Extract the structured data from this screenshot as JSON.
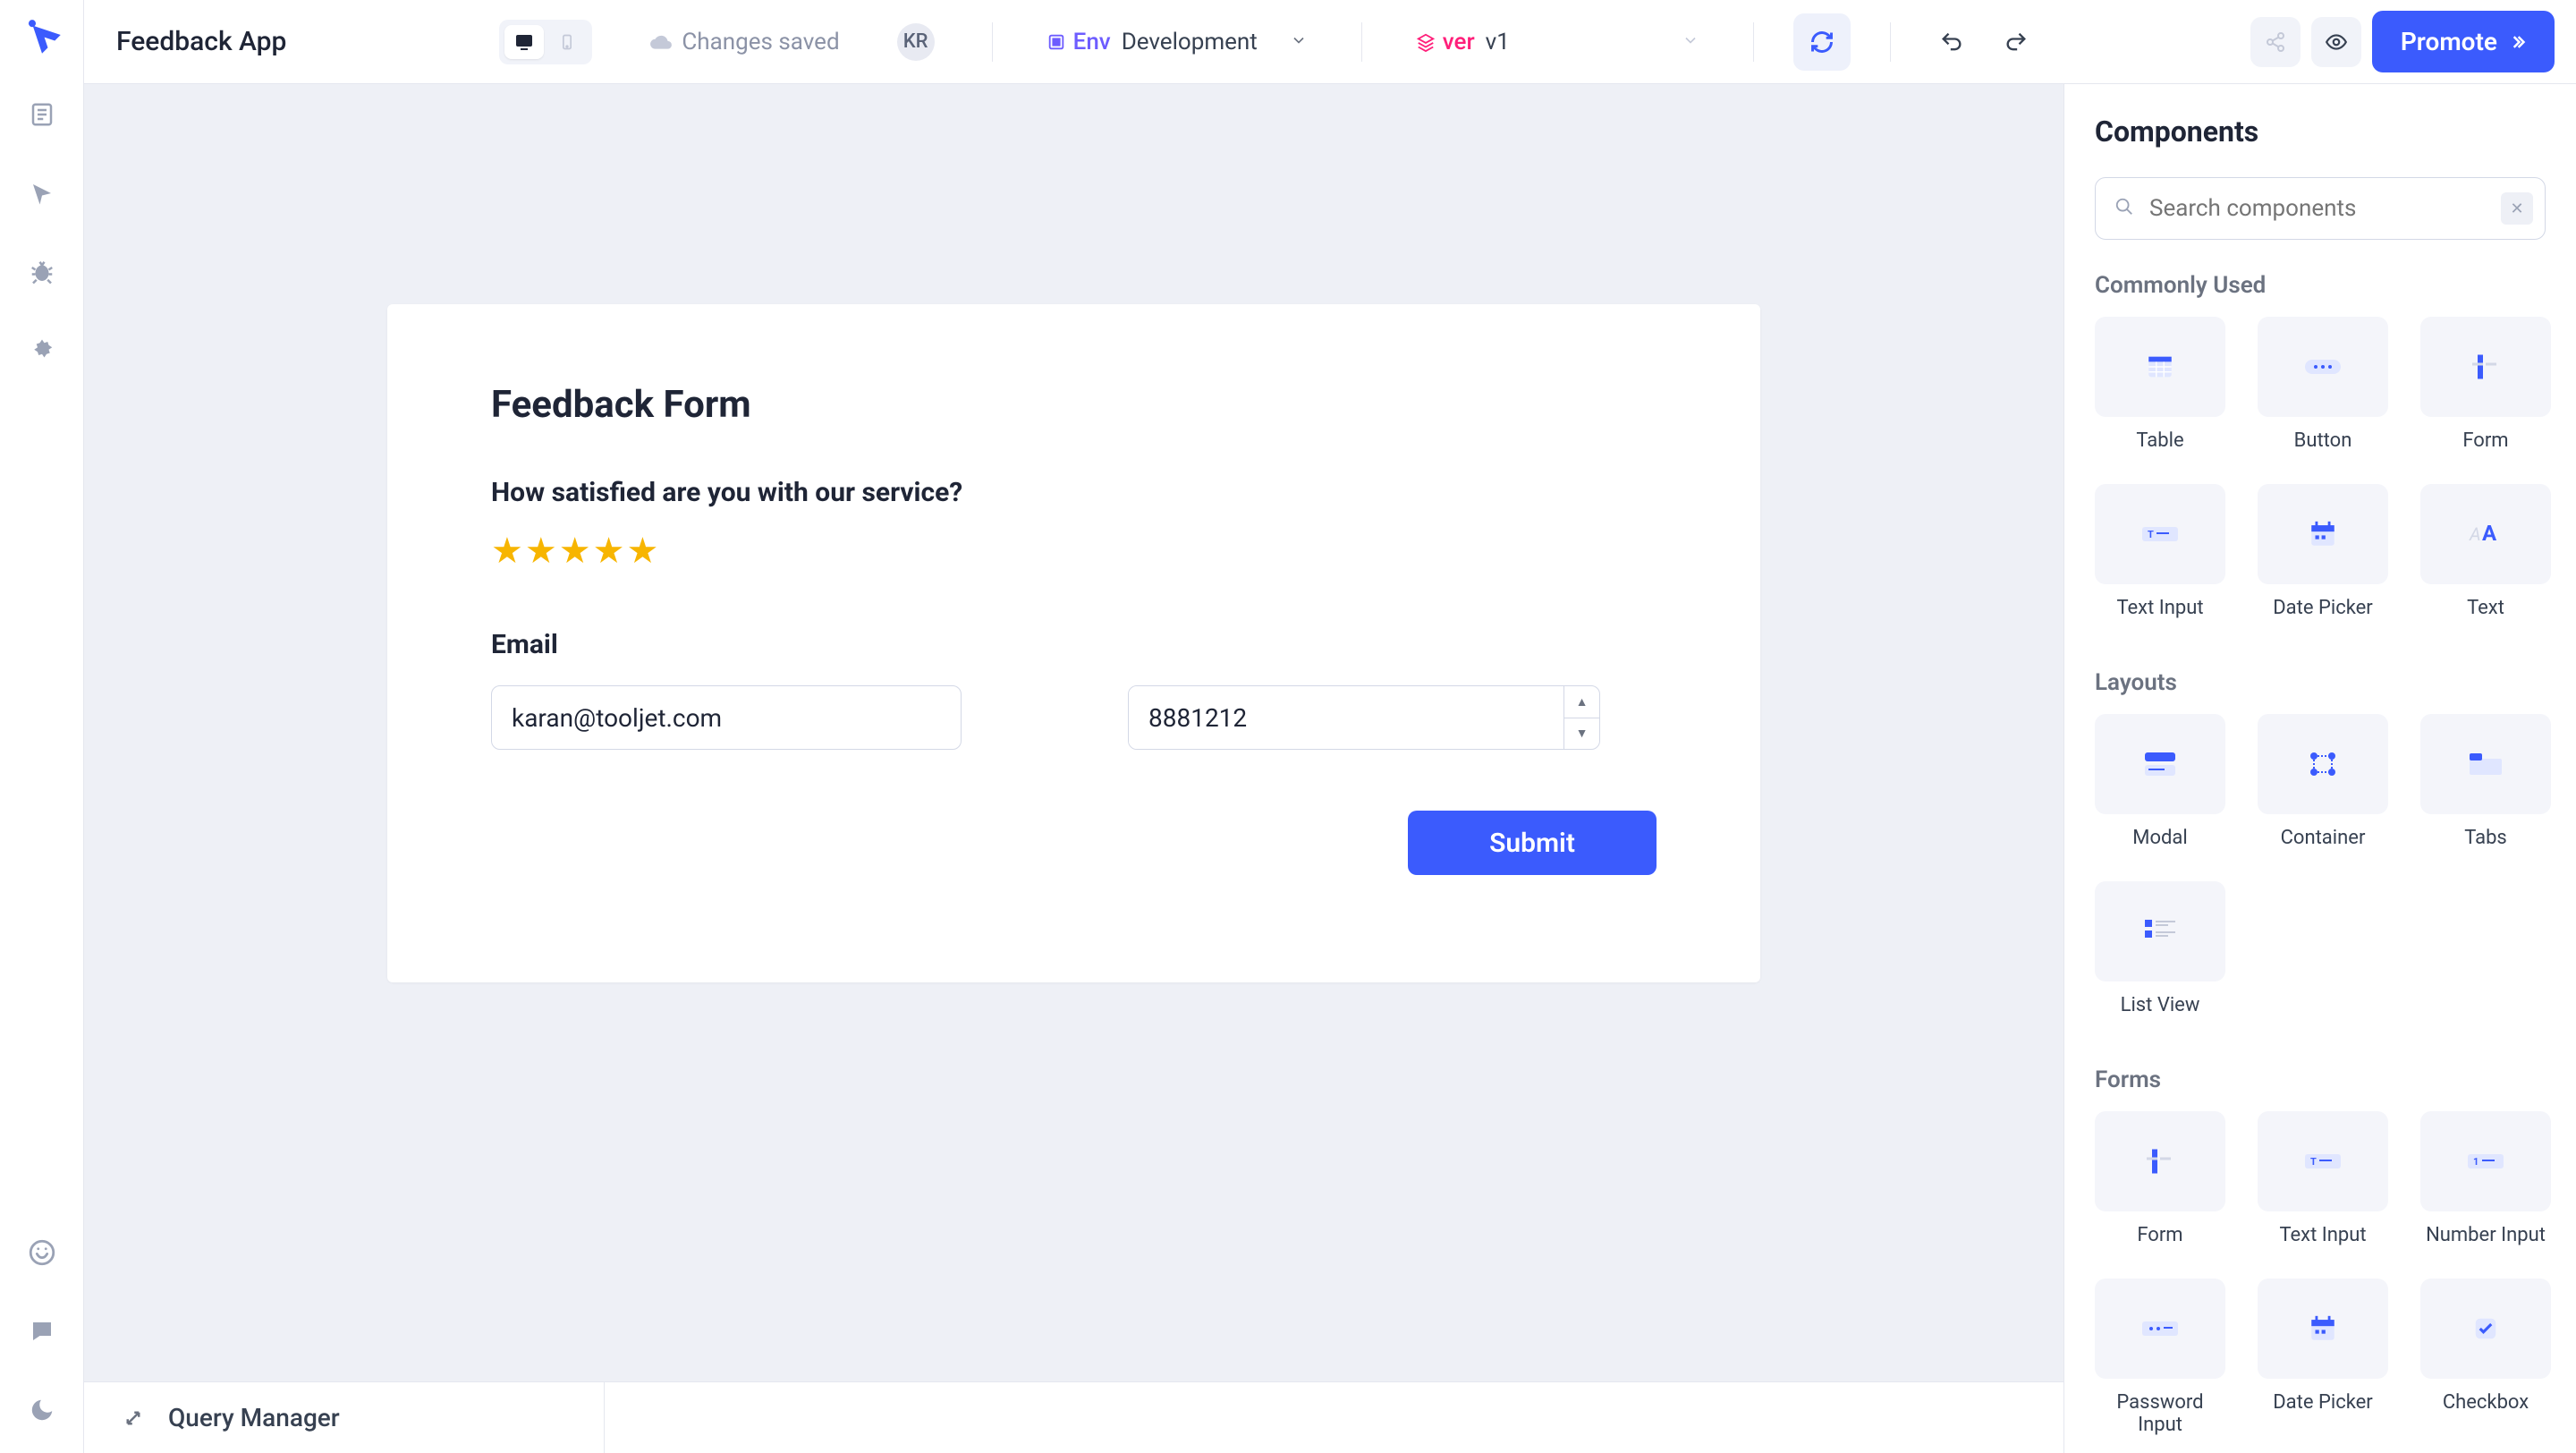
{
  "header": {
    "app_name": "Feedback App",
    "save_status": "Changes saved",
    "avatar_initials": "KR",
    "env_label": "Env",
    "env_value": "Development",
    "ver_label": "ver",
    "ver_value": "v1",
    "promote_label": "Promote"
  },
  "canvas": {
    "form_title": "Feedback Form",
    "question": "How satisfied are you with our service?",
    "rating": 5,
    "email_label": "Email",
    "email_value": "karan@tooljet.com",
    "number_value": "8881212",
    "submit_label": "Submit"
  },
  "bottom": {
    "query_manager": "Query Manager"
  },
  "right": {
    "title": "Components",
    "search_placeholder": "Search components",
    "sections": {
      "common": "Commonly Used",
      "layouts": "Layouts",
      "forms": "Forms"
    },
    "common_items": [
      {
        "label": "Table",
        "icon": "table"
      },
      {
        "label": "Button",
        "icon": "button"
      },
      {
        "label": "Form",
        "icon": "form"
      },
      {
        "label": "Text Input",
        "icon": "textinput"
      },
      {
        "label": "Date Picker",
        "icon": "datepicker"
      },
      {
        "label": "Text",
        "icon": "text"
      }
    ],
    "layout_items": [
      {
        "label": "Modal",
        "icon": "modal"
      },
      {
        "label": "Container",
        "icon": "container"
      },
      {
        "label": "Tabs",
        "icon": "tabs"
      },
      {
        "label": "List View",
        "icon": "listview"
      }
    ],
    "form_items": [
      {
        "label": "Form",
        "icon": "form"
      },
      {
        "label": "Text Input",
        "icon": "textinput"
      },
      {
        "label": "Number Input",
        "icon": "numberinput"
      },
      {
        "label": "Password Input",
        "icon": "password"
      },
      {
        "label": "Date Picker",
        "icon": "datepicker"
      },
      {
        "label": "Checkbox",
        "icon": "checkbox"
      }
    ]
  }
}
